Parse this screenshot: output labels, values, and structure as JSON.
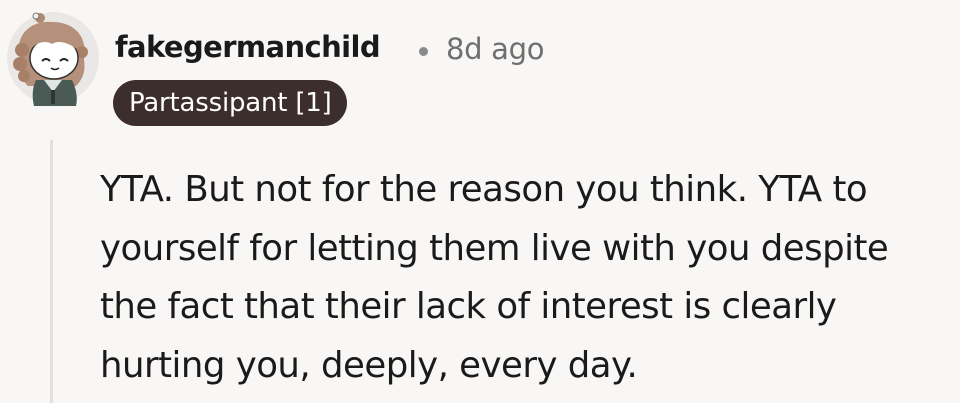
{
  "comment": {
    "username": "fakegermanchild",
    "separator": "•",
    "timestamp": "8d ago",
    "flair": "Partassipant [1]",
    "body": "YTA. But not for the reason you think. YTA to yourself for letting them live with you despite the fact that their lack of interest is clearly hurting you, deeply, every day."
  },
  "colors": {
    "background": "#f8f7f6",
    "flair_bg": "#3b2e2c",
    "flair_text": "#ffffff",
    "text": "#1a1a1b",
    "meta_text": "#6f6f6f",
    "thread_line": "#e2dfdc"
  },
  "icons": {
    "avatar": "user-avatar-snoo"
  }
}
